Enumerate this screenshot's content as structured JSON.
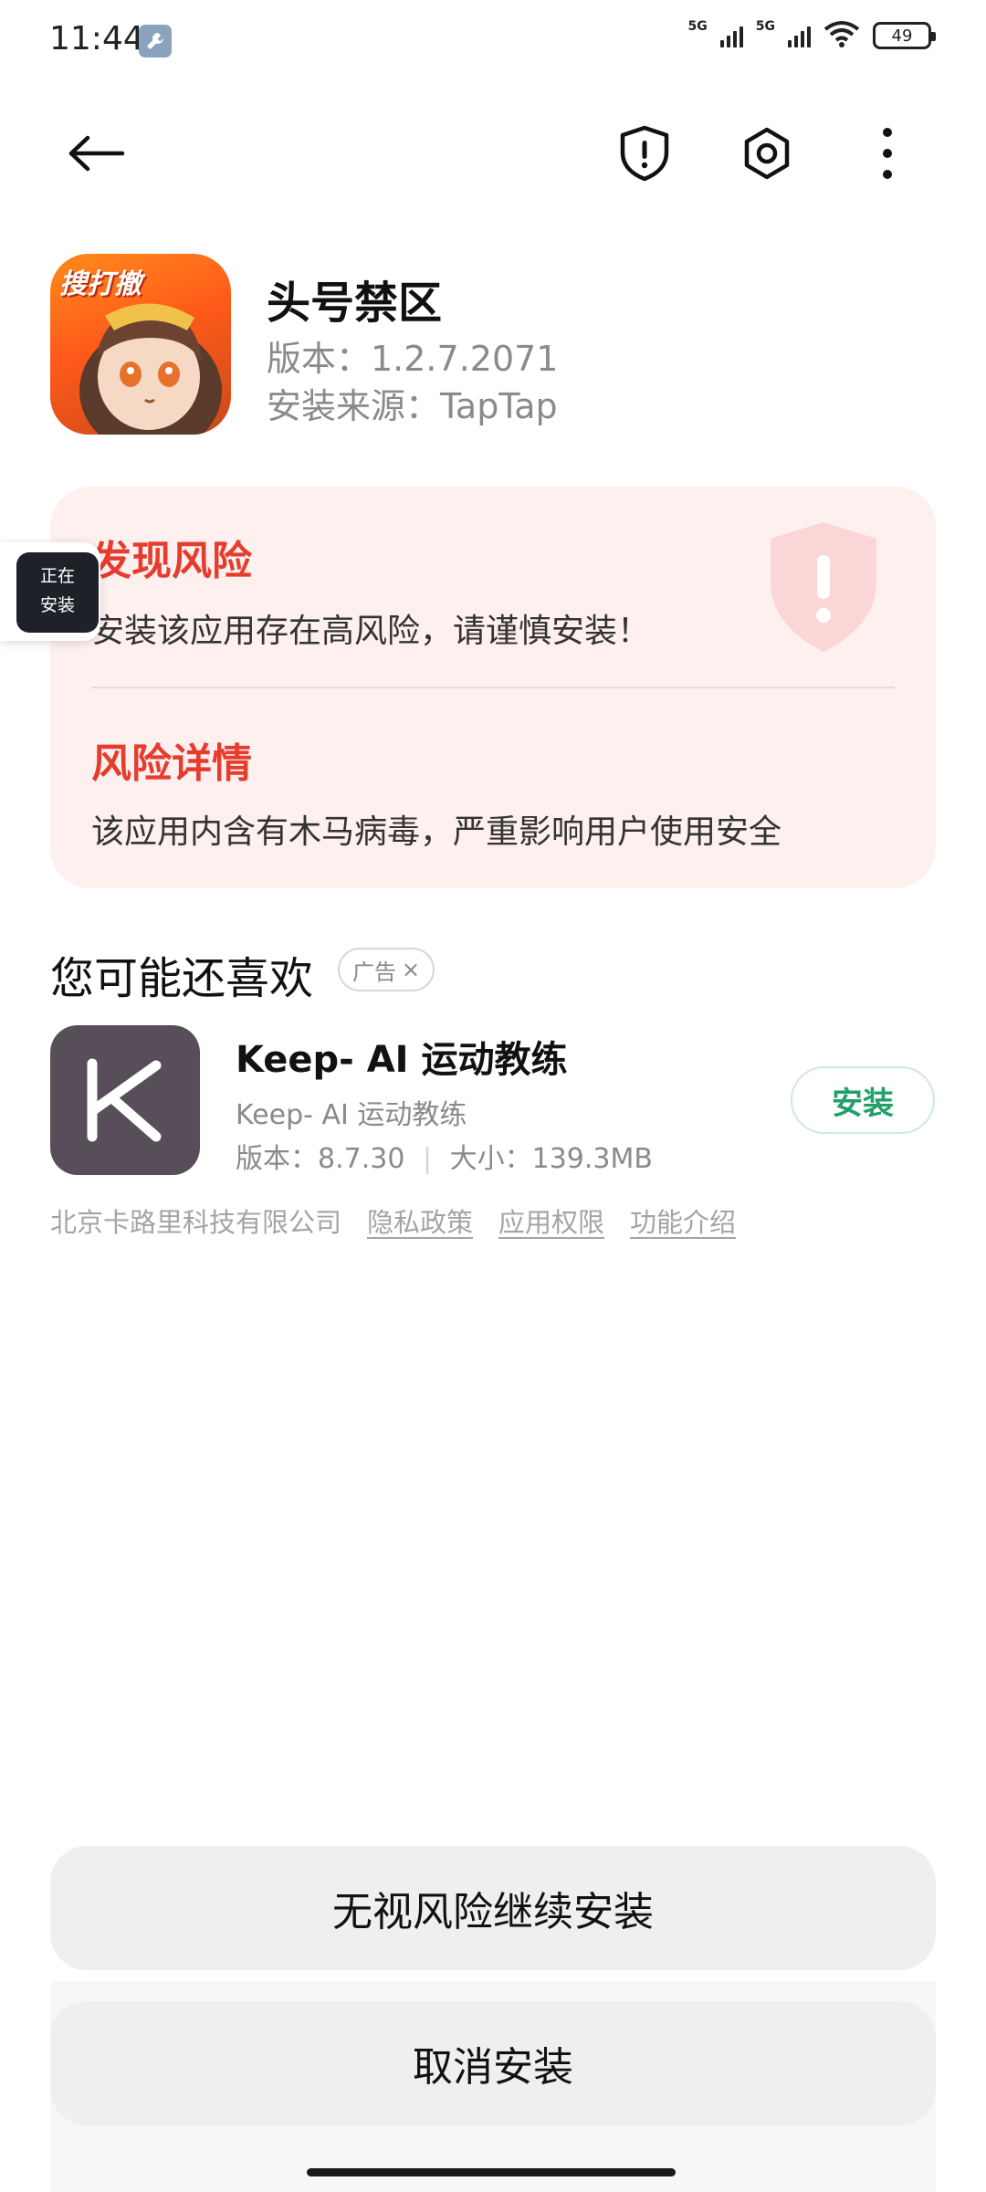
{
  "status_bar": {
    "time": "11:44",
    "network_1": "5G",
    "network_2": "5G",
    "battery": "49"
  },
  "toolbar": {
    "back_icon": "arrow-left-icon",
    "shield_icon": "shield-alert-icon",
    "settings_icon": "hexagon-settings-icon",
    "more_icon": "more-vertical-icon"
  },
  "app": {
    "name": "头号禁区",
    "version": "版本：1.2.7.2071",
    "source": "安装来源：TapTap",
    "icon_badge": "搜打撤"
  },
  "floating_chip": {
    "line1": "正在",
    "line2": "安装"
  },
  "risk": {
    "title": "发现风险",
    "message": "安装该应用存在高风险，请谨慎安装！",
    "details_title": "风险详情",
    "details_text": "该应用内含有木马病毒，严重影响用户使用安全",
    "accent_color": "#e63c2e"
  },
  "recommend": {
    "title": "您可能还喜欢",
    "ad_label": "广告",
    "ad_close": "×",
    "app_name": "Keep- AI 运动教练",
    "app_subtitle": "Keep- AI 运动教练",
    "version": "版本：8.7.30",
    "separator": "|",
    "size": "大小：139.3MB",
    "install_label": "安装",
    "developer": "北京卡路里科技有限公司",
    "privacy": "隐私政策",
    "permissions": "应用权限",
    "features": "功能介绍"
  },
  "actions": {
    "continue_label": "无视风险继续安装",
    "cancel_label": "取消安装"
  }
}
